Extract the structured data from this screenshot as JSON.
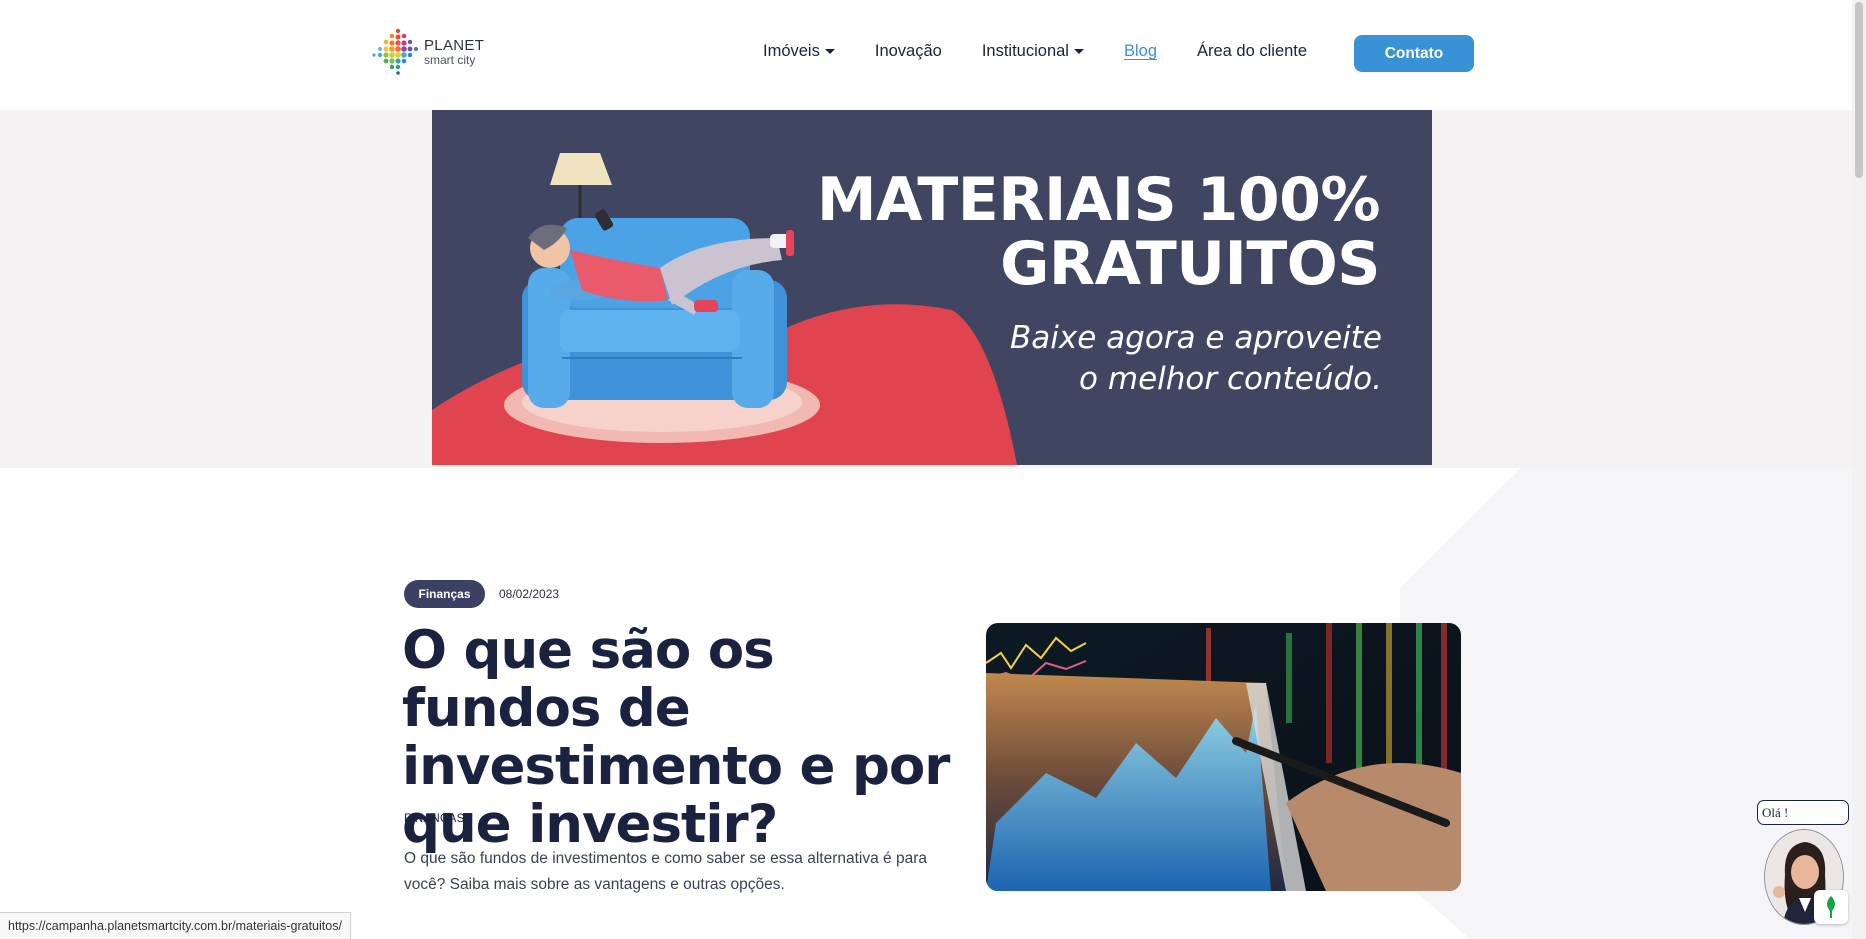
{
  "header": {
    "logo": {
      "line1": "PLANET",
      "line2": "smart city"
    },
    "nav": [
      {
        "label": "Imóveis",
        "has_dropdown": true,
        "active": false
      },
      {
        "label": "Inovação",
        "has_dropdown": false,
        "active": false
      },
      {
        "label": "Institucional",
        "has_dropdown": true,
        "active": false
      },
      {
        "label": "Blog",
        "has_dropdown": false,
        "active": true
      },
      {
        "label": "Área do cliente",
        "has_dropdown": false,
        "active": false
      }
    ],
    "contact_button": "Contato"
  },
  "banner": {
    "title_line1": "MATERIAIS 100%",
    "title_line2": "GRATUITOS",
    "subtitle_line1": "Baixe agora e aproveite",
    "subtitle_line2": "o melhor conteúdo."
  },
  "post": {
    "badge": "Finanças",
    "date": "08/02/2023",
    "title": "O que são os fundos de investimento e por que investir?",
    "category": "FINANÇAS",
    "excerpt": "O que são fundos de investimentos e como saber se essa alternativa é para você? Saiba mais sobre as vantagens e outras opções."
  },
  "status_bar": {
    "url": "https://campanha.planetsmartcity.com.br/materiais-gratuitos/"
  },
  "chat": {
    "greeting": "Olá !"
  },
  "colors": {
    "primary_blue": "#3a92d6",
    "navy": "#1b2240",
    "banner_bg": "#404562",
    "banner_accent": "#e0454f"
  }
}
